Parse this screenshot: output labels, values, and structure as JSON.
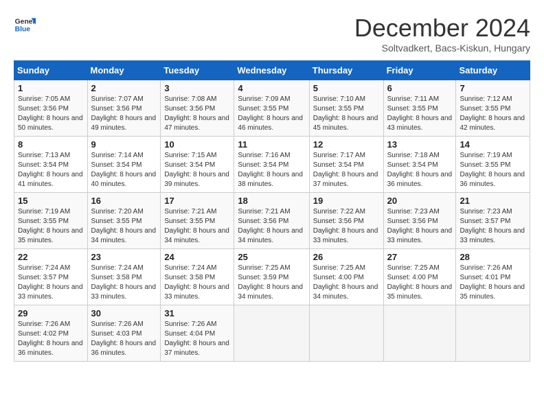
{
  "logo": {
    "line1": "General",
    "line2": "Blue"
  },
  "title": "December 2024",
  "subtitle": "Soltvadkert, Bacs-Kiskun, Hungary",
  "days_of_week": [
    "Sunday",
    "Monday",
    "Tuesday",
    "Wednesday",
    "Thursday",
    "Friday",
    "Saturday"
  ],
  "weeks": [
    [
      {
        "day": "1",
        "sunrise": "7:05 AM",
        "sunset": "3:56 PM",
        "daylight": "8 hours and 50 minutes."
      },
      {
        "day": "2",
        "sunrise": "7:07 AM",
        "sunset": "3:56 PM",
        "daylight": "8 hours and 49 minutes."
      },
      {
        "day": "3",
        "sunrise": "7:08 AM",
        "sunset": "3:56 PM",
        "daylight": "8 hours and 47 minutes."
      },
      {
        "day": "4",
        "sunrise": "7:09 AM",
        "sunset": "3:55 PM",
        "daylight": "8 hours and 46 minutes."
      },
      {
        "day": "5",
        "sunrise": "7:10 AM",
        "sunset": "3:55 PM",
        "daylight": "8 hours and 45 minutes."
      },
      {
        "day": "6",
        "sunrise": "7:11 AM",
        "sunset": "3:55 PM",
        "daylight": "8 hours and 43 minutes."
      },
      {
        "day": "7",
        "sunrise": "7:12 AM",
        "sunset": "3:55 PM",
        "daylight": "8 hours and 42 minutes."
      }
    ],
    [
      {
        "day": "8",
        "sunrise": "7:13 AM",
        "sunset": "3:54 PM",
        "daylight": "8 hours and 41 minutes."
      },
      {
        "day": "9",
        "sunrise": "7:14 AM",
        "sunset": "3:54 PM",
        "daylight": "8 hours and 40 minutes."
      },
      {
        "day": "10",
        "sunrise": "7:15 AM",
        "sunset": "3:54 PM",
        "daylight": "8 hours and 39 minutes."
      },
      {
        "day": "11",
        "sunrise": "7:16 AM",
        "sunset": "3:54 PM",
        "daylight": "8 hours and 38 minutes."
      },
      {
        "day": "12",
        "sunrise": "7:17 AM",
        "sunset": "3:54 PM",
        "daylight": "8 hours and 37 minutes."
      },
      {
        "day": "13",
        "sunrise": "7:18 AM",
        "sunset": "3:54 PM",
        "daylight": "8 hours and 36 minutes."
      },
      {
        "day": "14",
        "sunrise": "7:19 AM",
        "sunset": "3:55 PM",
        "daylight": "8 hours and 36 minutes."
      }
    ],
    [
      {
        "day": "15",
        "sunrise": "7:19 AM",
        "sunset": "3:55 PM",
        "daylight": "8 hours and 35 minutes."
      },
      {
        "day": "16",
        "sunrise": "7:20 AM",
        "sunset": "3:55 PM",
        "daylight": "8 hours and 34 minutes."
      },
      {
        "day": "17",
        "sunrise": "7:21 AM",
        "sunset": "3:55 PM",
        "daylight": "8 hours and 34 minutes."
      },
      {
        "day": "18",
        "sunrise": "7:21 AM",
        "sunset": "3:56 PM",
        "daylight": "8 hours and 34 minutes."
      },
      {
        "day": "19",
        "sunrise": "7:22 AM",
        "sunset": "3:56 PM",
        "daylight": "8 hours and 33 minutes."
      },
      {
        "day": "20",
        "sunrise": "7:23 AM",
        "sunset": "3:56 PM",
        "daylight": "8 hours and 33 minutes."
      },
      {
        "day": "21",
        "sunrise": "7:23 AM",
        "sunset": "3:57 PM",
        "daylight": "8 hours and 33 minutes."
      }
    ],
    [
      {
        "day": "22",
        "sunrise": "7:24 AM",
        "sunset": "3:57 PM",
        "daylight": "8 hours and 33 minutes."
      },
      {
        "day": "23",
        "sunrise": "7:24 AM",
        "sunset": "3:58 PM",
        "daylight": "8 hours and 33 minutes."
      },
      {
        "day": "24",
        "sunrise": "7:24 AM",
        "sunset": "3:58 PM",
        "daylight": "8 hours and 33 minutes."
      },
      {
        "day": "25",
        "sunrise": "7:25 AM",
        "sunset": "3:59 PM",
        "daylight": "8 hours and 34 minutes."
      },
      {
        "day": "26",
        "sunrise": "7:25 AM",
        "sunset": "4:00 PM",
        "daylight": "8 hours and 34 minutes."
      },
      {
        "day": "27",
        "sunrise": "7:25 AM",
        "sunset": "4:00 PM",
        "daylight": "8 hours and 35 minutes."
      },
      {
        "day": "28",
        "sunrise": "7:26 AM",
        "sunset": "4:01 PM",
        "daylight": "8 hours and 35 minutes."
      }
    ],
    [
      {
        "day": "29",
        "sunrise": "7:26 AM",
        "sunset": "4:02 PM",
        "daylight": "8 hours and 36 minutes."
      },
      {
        "day": "30",
        "sunrise": "7:26 AM",
        "sunset": "4:03 PM",
        "daylight": "8 hours and 36 minutes."
      },
      {
        "day": "31",
        "sunrise": "7:26 AM",
        "sunset": "4:04 PM",
        "daylight": "8 hours and 37 minutes."
      },
      null,
      null,
      null,
      null
    ]
  ]
}
